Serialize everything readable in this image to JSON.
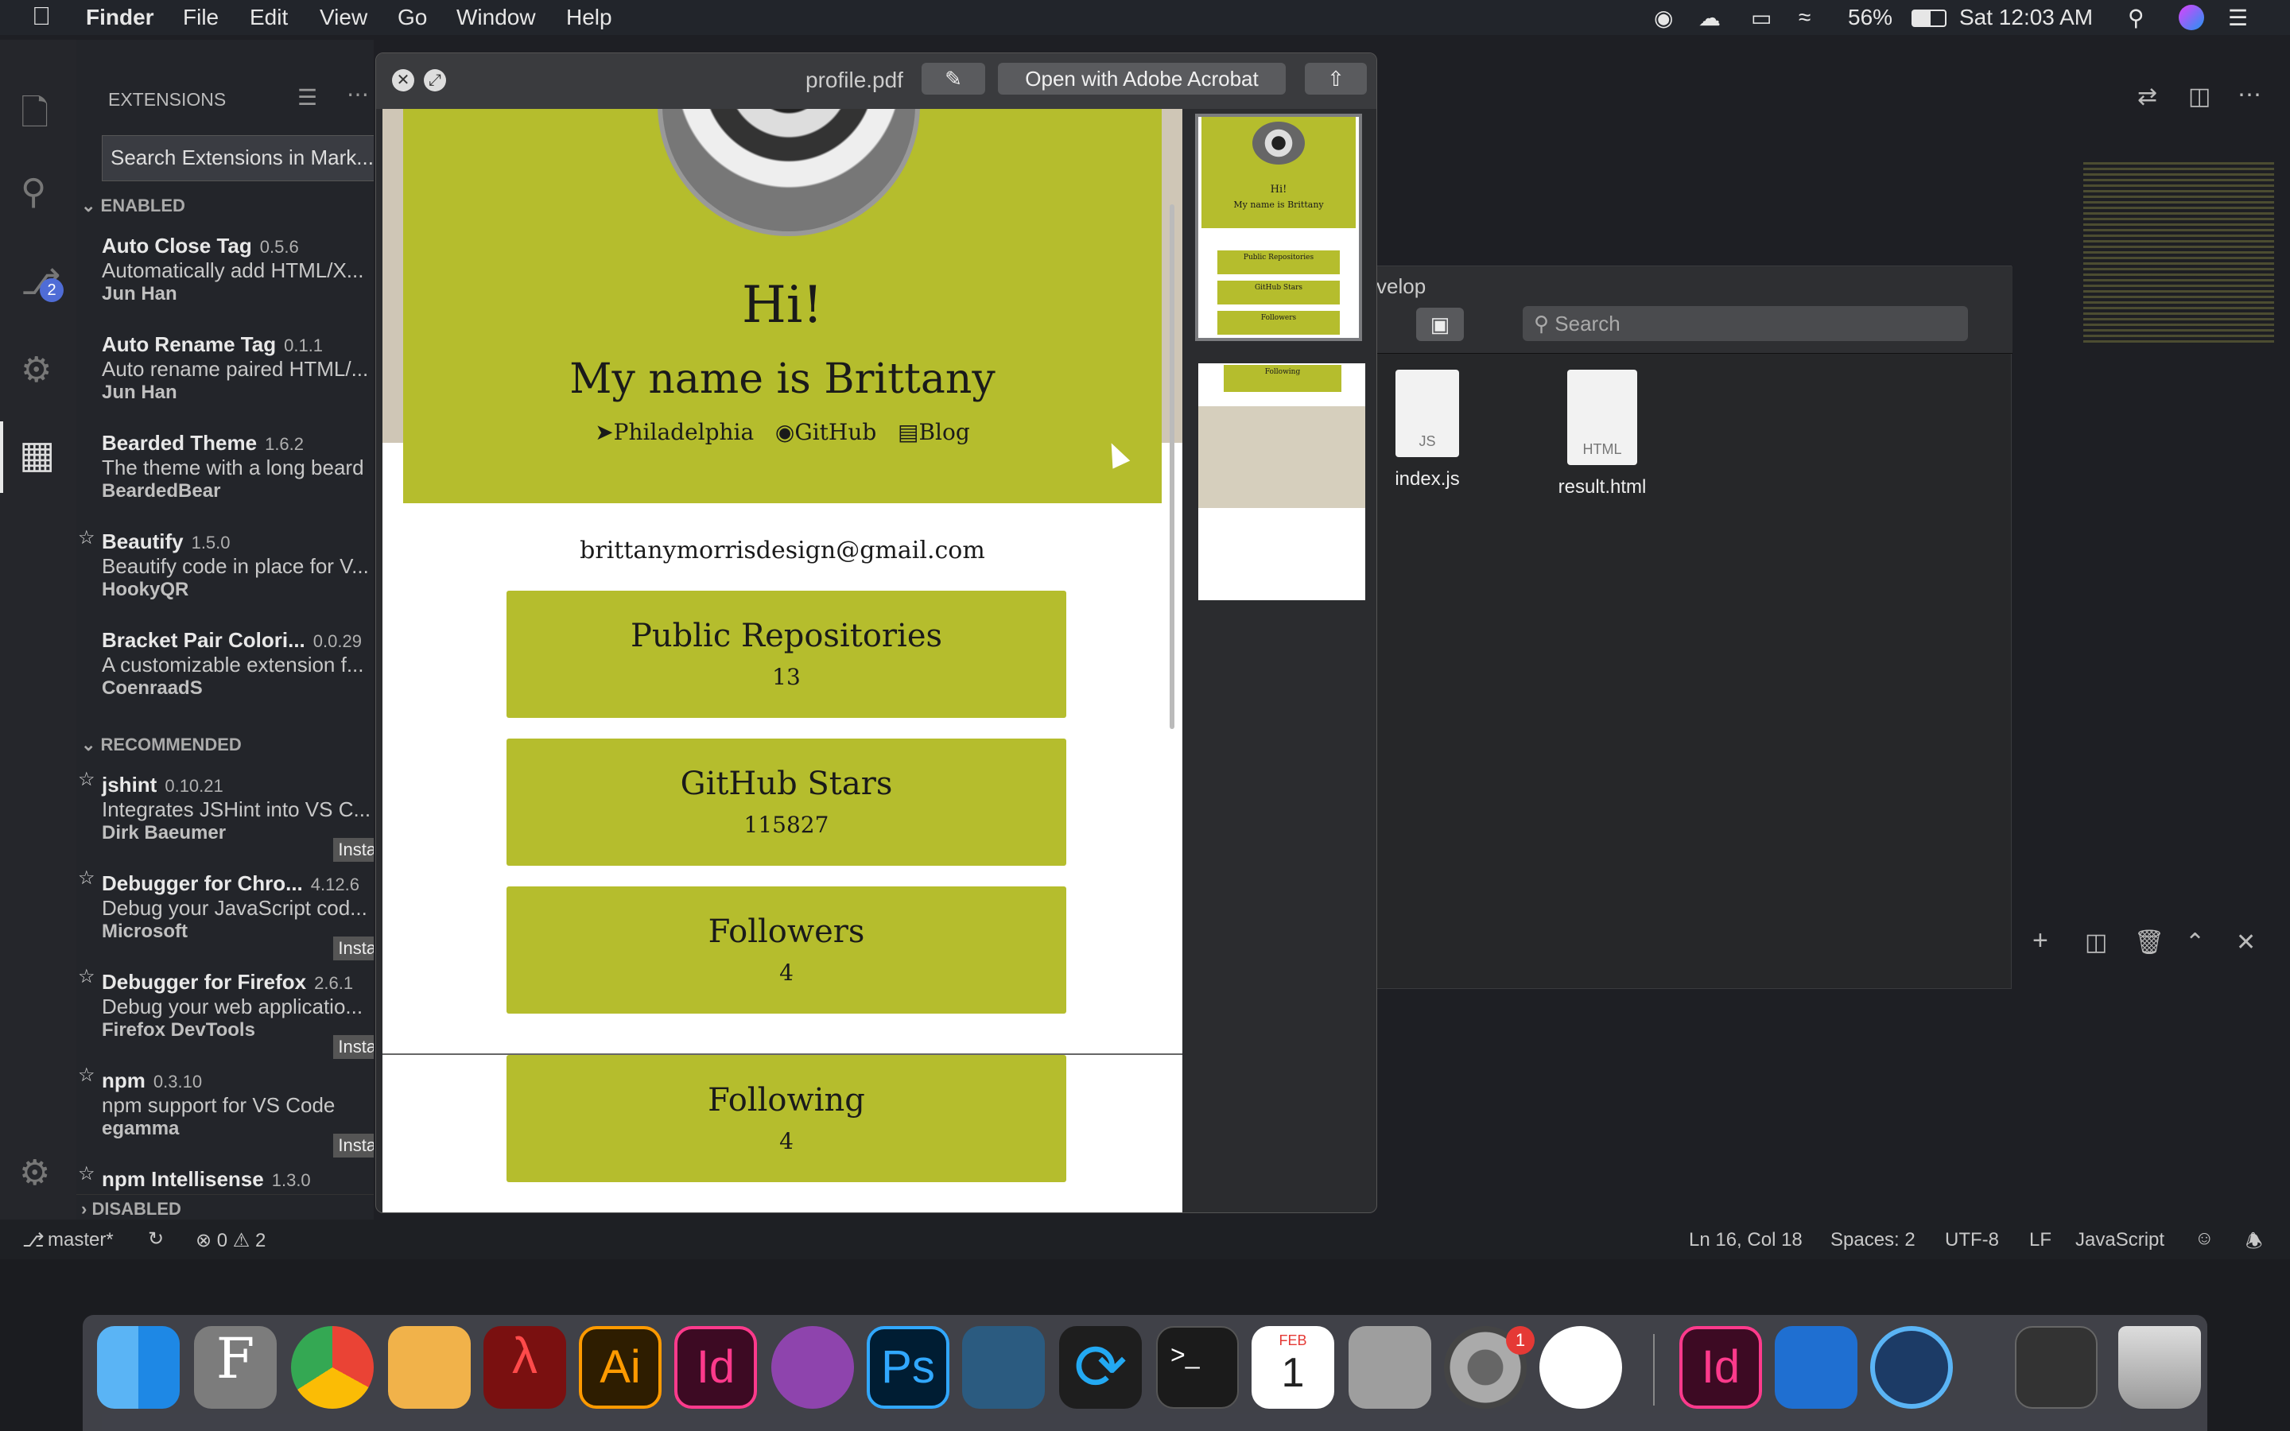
{
  "menubar": {
    "app": "Finder",
    "items": [
      "File",
      "Edit",
      "View",
      "Go",
      "Window",
      "Help"
    ],
    "battery": "56%",
    "clock": "Sat 12:03 AM"
  },
  "sidebar": {
    "title": "EXTENSIONS",
    "search_placeholder": "Search Extensions in Mark...",
    "enabled_header": "ENABLED",
    "recommended_header": "RECOMMENDED",
    "disabled_header": "DISABLED",
    "install_label": "Instal",
    "enabled": [
      {
        "name": "Auto Close Tag",
        "version": "0.5.6",
        "desc": "Automatically add HTML/X...",
        "publisher": "Jun Han"
      },
      {
        "name": "Auto Rename Tag",
        "version": "0.1.1",
        "desc": "Auto rename paired HTML/...",
        "publisher": "Jun Han"
      },
      {
        "name": "Bearded Theme",
        "version": "1.6.2",
        "desc": "The theme with a long beard",
        "publisher": "BeardedBear"
      },
      {
        "name": "Beautify",
        "version": "1.5.0",
        "desc": "Beautify code in place for V...",
        "publisher": "HookyQR"
      },
      {
        "name": "Bracket Pair Colori...",
        "version": "0.0.29",
        "desc": "A customizable extension f...",
        "publisher": "CoenraadS"
      }
    ],
    "recommended": [
      {
        "name": "jshint",
        "version": "0.10.21",
        "desc": "Integrates JSHint into VS C...",
        "publisher": "Dirk Baeumer"
      },
      {
        "name": "Debugger for Chro...",
        "version": "4.12.6",
        "desc": "Debug your JavaScript cod...",
        "publisher": "Microsoft"
      },
      {
        "name": "Debugger for Firefox",
        "version": "2.6.1",
        "desc": "Debug your web applicatio...",
        "publisher": "Firefox DevTools"
      },
      {
        "name": "npm",
        "version": "0.3.10",
        "desc": "npm support for VS Code",
        "publisher": "egamma"
      },
      {
        "name": "npm Intellisense",
        "version": "1.3.0",
        "desc": "",
        "publisher": ""
      }
    ],
    "scm_badge": "2"
  },
  "statusbar": {
    "branch": "master*",
    "errors": "0",
    "warnings": "2",
    "position": "Ln 16, Col 18",
    "spaces": "Spaces: 2",
    "encoding": "UTF-8",
    "eol": "LF",
    "language": "JavaScript"
  },
  "finder": {
    "title_fragment": "velop",
    "search_placeholder": "Search",
    "files": [
      {
        "name": "index.js",
        "tag": "JS"
      },
      {
        "name": "result.html",
        "tag": "HTML"
      }
    ]
  },
  "quicklook": {
    "filename": "profile.pdf",
    "open_button": "Open with Adobe Acrobat",
    "page": {
      "greeting": "Hi!",
      "name_line": "My name is Brittany",
      "links": [
        "Philadelphia",
        "GitHub",
        "Blog"
      ],
      "email": "brittanymorrisdesign@gmail.com",
      "stats": [
        {
          "label": "Public Repositories",
          "value": "13"
        },
        {
          "label": "GitHub Stars",
          "value": "115827"
        },
        {
          "label": "Followers",
          "value": "4"
        },
        {
          "label": "Following",
          "value": "4"
        }
      ]
    },
    "thumb": {
      "greeting": "Hi!",
      "name_line": "My name is Brittany",
      "stats": [
        "Public Repositories",
        "GitHub Stars",
        "Followers",
        "Following"
      ]
    }
  },
  "dock": {
    "calendar_month": "FEB",
    "calendar_day": "1",
    "prefs_badge": "1",
    "apps": [
      "Finder",
      "Font Book",
      "Chrome",
      "Preview",
      "Acrobat",
      "Illustrator",
      "InDesign",
      "GitHub Desktop",
      "Photoshop",
      "MySQL Workbench",
      "VS Code",
      "Terminal",
      "Calendar",
      "Calculator",
      "System Preferences",
      "Slack",
      "InDesign",
      "Xcode",
      "QuickTime"
    ]
  },
  "colors": {
    "olive": "#b5bd2d",
    "accent": "#4f6cd6",
    "badge": "#e53935"
  }
}
